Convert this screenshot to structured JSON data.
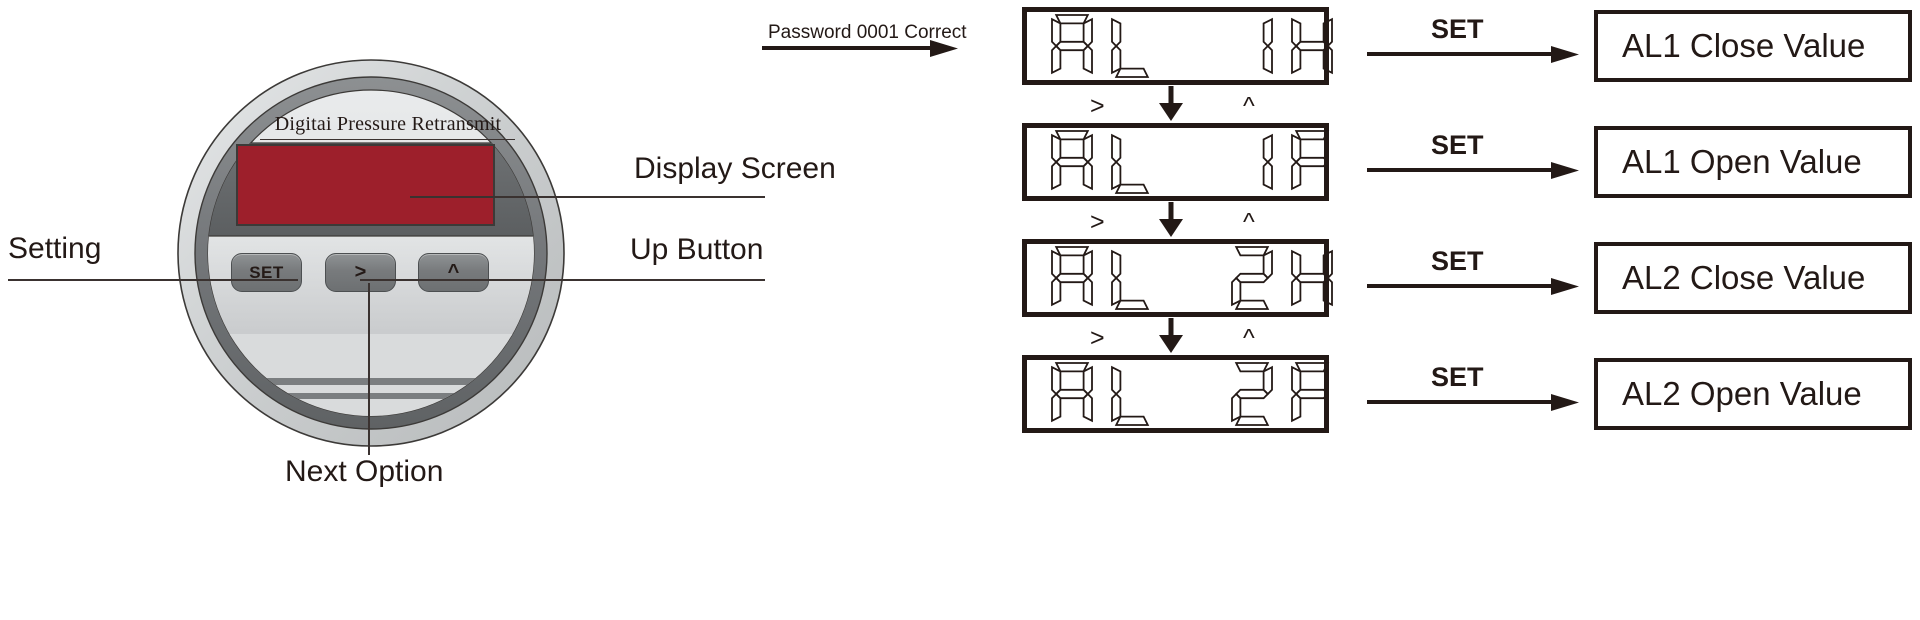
{
  "device": {
    "brand_label": "Digitai Pressure Retransmit",
    "buttons": {
      "set": "SET",
      "next": ">",
      "up": "^"
    },
    "screen_color": "#9d1f2b",
    "bezel_color": "#c9cbcc"
  },
  "callouts": {
    "setting": "Setting",
    "display_screen": "Display Screen",
    "up_button": "Up Button",
    "next_option": "Next Option"
  },
  "flow": {
    "entry_label": "Password 0001 Correct",
    "set_label": "SET",
    "next_marker": ">",
    "up_marker": "^",
    "steps": [
      {
        "lcd": "AL 1H",
        "chars": [
          "A",
          "L",
          "blank",
          "1",
          "H"
        ],
        "result": "AL1 Close Value"
      },
      {
        "lcd": "AL 1F",
        "chars": [
          "A",
          "L",
          "blank",
          "1",
          "F"
        ],
        "result": "AL1 Open Value"
      },
      {
        "lcd": "AL 2H",
        "chars": [
          "A",
          "L",
          "blank",
          "2",
          "H"
        ],
        "result": "AL2 Close Value"
      },
      {
        "lcd": "AL 2F",
        "chars": [
          "A",
          "L",
          "blank",
          "2",
          "F"
        ],
        "result": "AL2 Open Value"
      }
    ]
  },
  "colors": {
    "ink": "#231916",
    "screen_red": "#9d1f2b",
    "metal_light": "#d6d8d9",
    "metal_dark": "#6e7173"
  }
}
